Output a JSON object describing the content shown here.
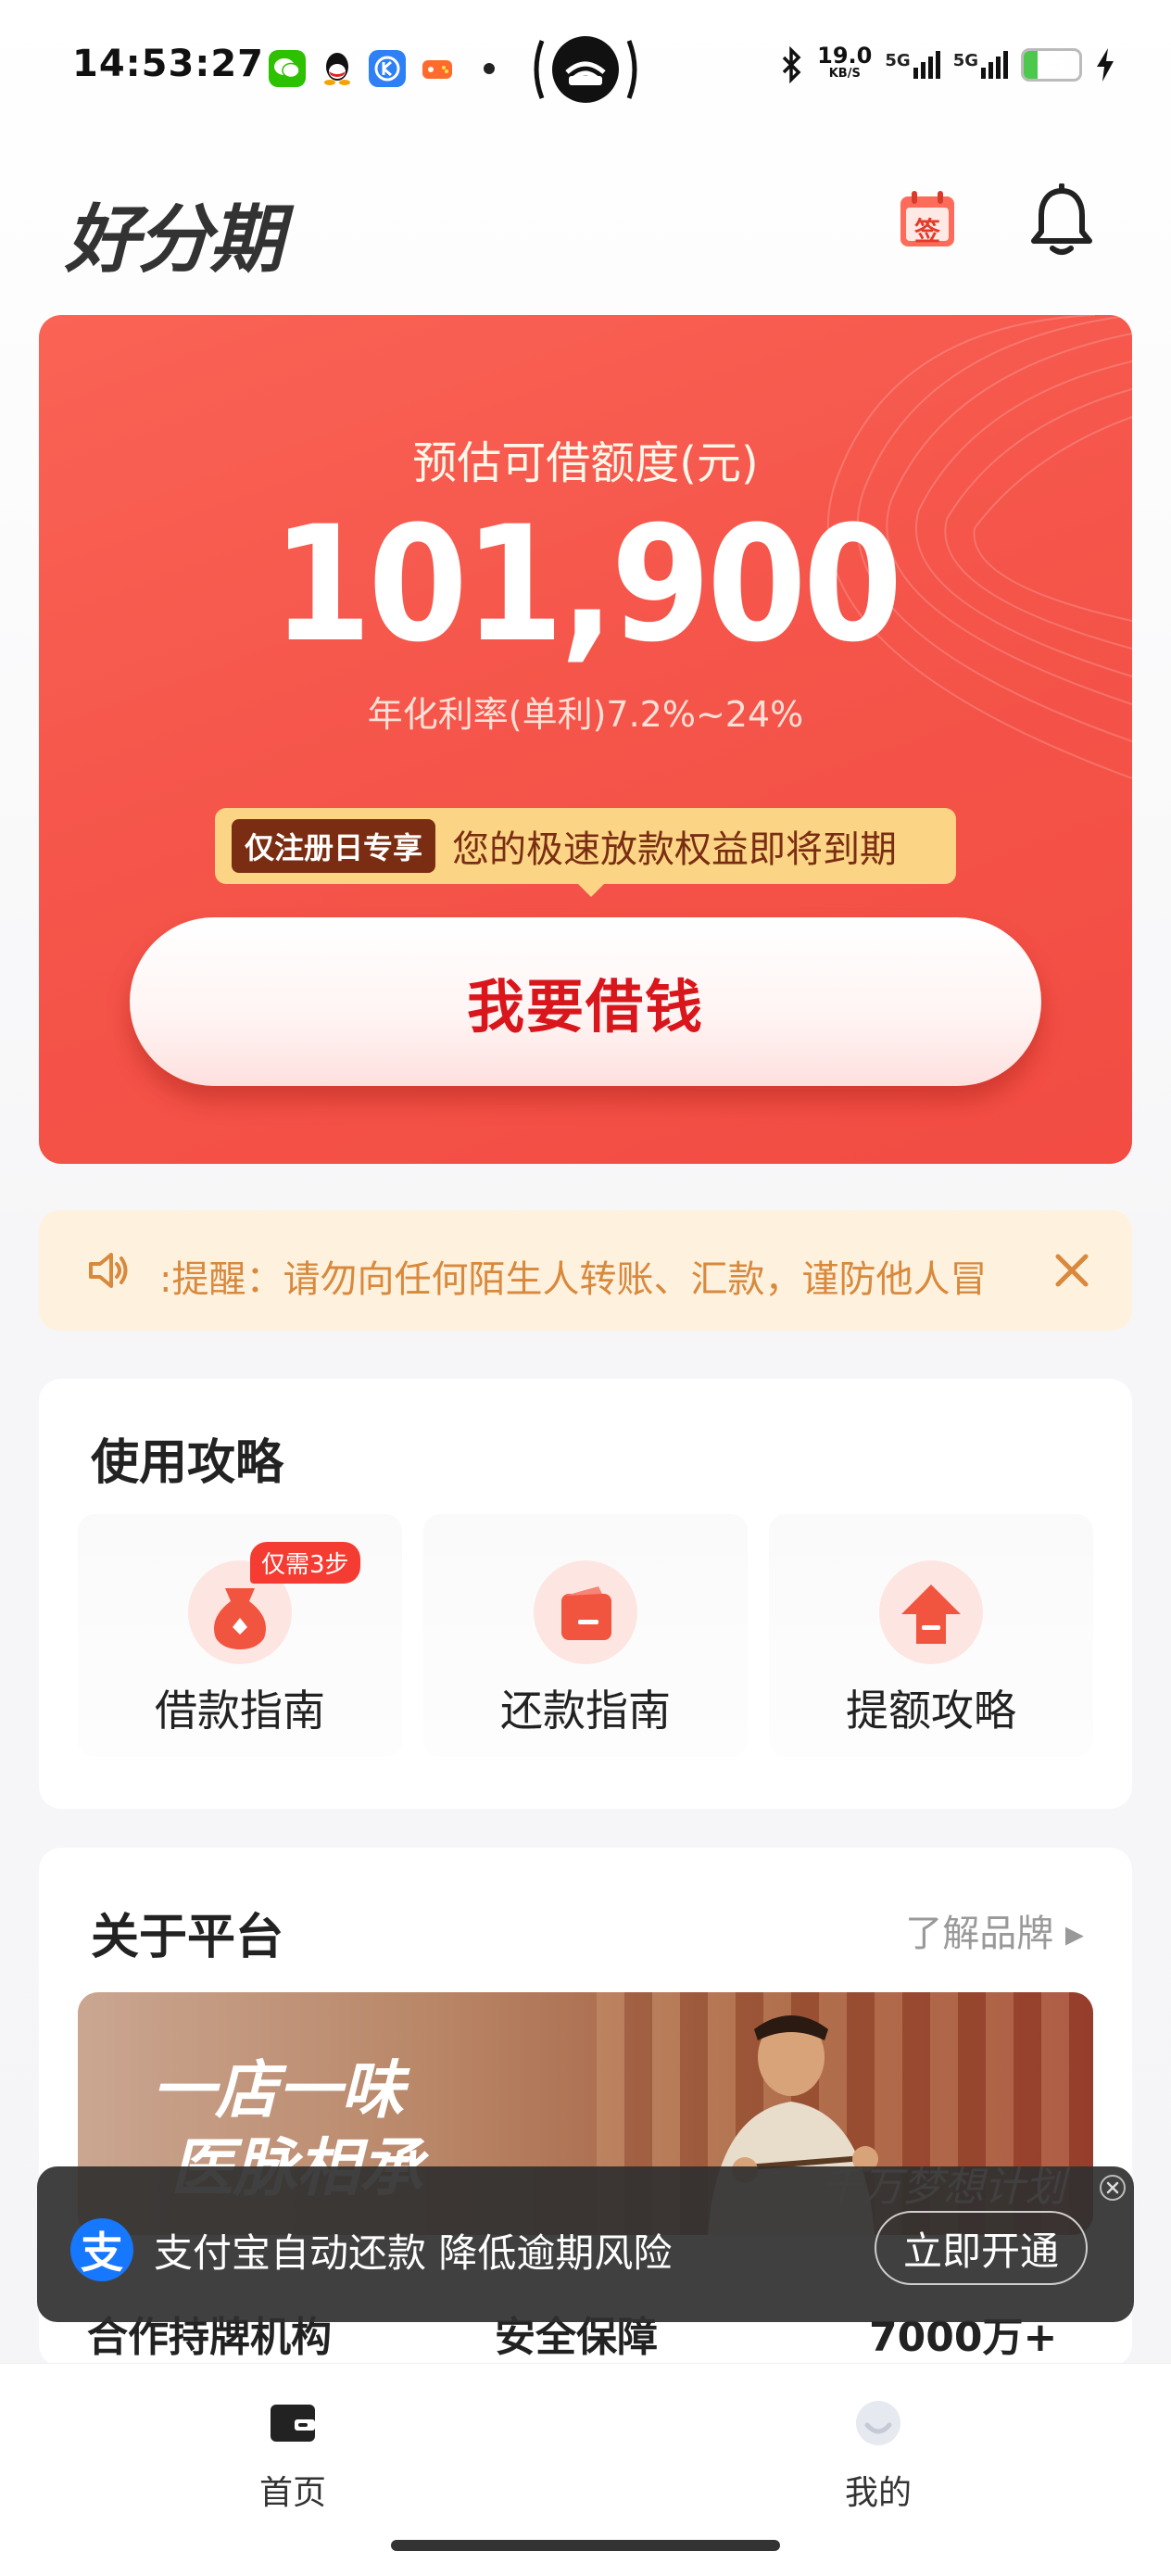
{
  "status_bar": {
    "time": "14:53:27",
    "net_speed": "19.0",
    "net_unit": "KB/S",
    "signal1": "5G",
    "signal2": "5G",
    "battery": "25",
    "battery_level": 0.25,
    "icons": [
      "wechat-icon",
      "qq-icon",
      "kuwo-icon",
      "game-icon",
      "bluetooth-icon",
      "charging-icon"
    ]
  },
  "header": {
    "logo": "好分期",
    "calendar_label": "签",
    "bell_icon": "bell-icon"
  },
  "hero": {
    "label": "预估可借额度(元)",
    "amount": "101,900",
    "rate": "年化利率(单利)7.2%~24%",
    "tag": "仅注册日专享",
    "banner_text": "您的极速放款权益即将到期",
    "button": "我要借钱"
  },
  "notice": {
    "text": ":提醒：请勿向任何陌生人转账、汇款，谨防他人冒"
  },
  "guide": {
    "title": "使用攻略",
    "items": [
      {
        "label": "借款指南",
        "badge": "仅需3步"
      },
      {
        "label": "还款指南"
      },
      {
        "label": "提额攻略"
      }
    ]
  },
  "about": {
    "title": "关于平台",
    "link": "了解品牌 ▸",
    "banner_text_1": "一店一味",
    "banner_text_2": "医脉相承",
    "banner_right": "千万梦想计划"
  },
  "stats": [
    "合作持牌机构",
    "安全保障",
    "7000万+"
  ],
  "toast": {
    "logo": "支",
    "text": "支付宝自动还款 降低逾期风险",
    "button": "立即开通"
  },
  "nav": [
    {
      "label": "首页",
      "icon": "wallet-icon"
    },
    {
      "label": "我的",
      "icon": "profile-icon"
    }
  ],
  "colors": {
    "primary_red": "#f5554a",
    "button_text": "#d8161b",
    "notice_bg": "#fef1de",
    "notice_text": "#d8893c",
    "banner_yellow": "#fbd585",
    "alipay_blue": "#1677ff"
  }
}
